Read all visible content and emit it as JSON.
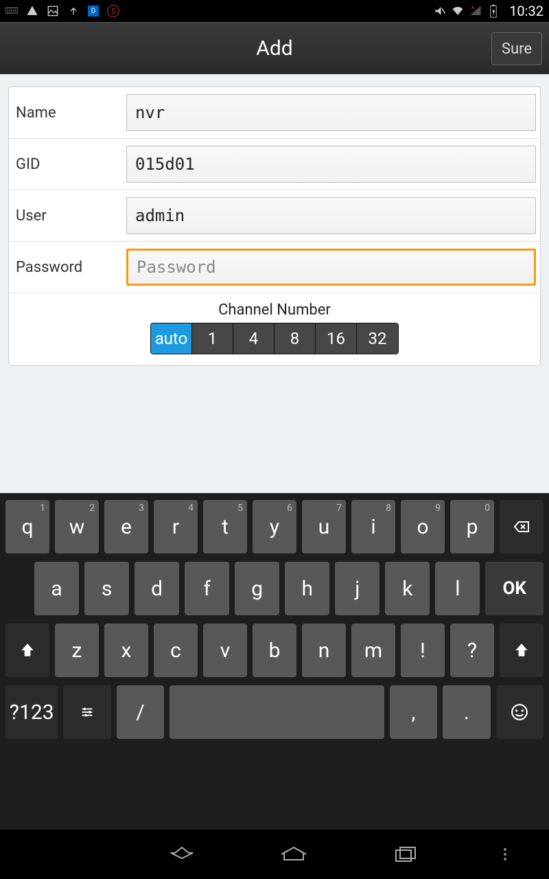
{
  "status": {
    "time": "10:32"
  },
  "header": {
    "title": "Add",
    "sure": "Sure"
  },
  "form": {
    "name": {
      "label": "Name",
      "value": "nvr"
    },
    "gid": {
      "label": "GID",
      "value": "015d01"
    },
    "user": {
      "label": "User",
      "value": "admin"
    },
    "password": {
      "label": "Password",
      "value": "",
      "placeholder": "Password"
    }
  },
  "channel": {
    "label": "Channel Number",
    "options": [
      "auto",
      "1",
      "4",
      "8",
      "16",
      "32"
    ],
    "selected": "auto"
  },
  "keyboard": {
    "row1": [
      {
        "k": "q",
        "n": "1"
      },
      {
        "k": "w",
        "n": "2"
      },
      {
        "k": "e",
        "n": "3"
      },
      {
        "k": "r",
        "n": "4"
      },
      {
        "k": "t",
        "n": "5"
      },
      {
        "k": "y",
        "n": "6"
      },
      {
        "k": "u",
        "n": "7"
      },
      {
        "k": "i",
        "n": "8"
      },
      {
        "k": "o",
        "n": "9"
      },
      {
        "k": "p",
        "n": "0"
      }
    ],
    "row2": [
      "a",
      "s",
      "d",
      "f",
      "g",
      "h",
      "j",
      "k",
      "l"
    ],
    "ok": "OK",
    "row3": [
      "z",
      "x",
      "c",
      "v",
      "b",
      "n",
      "m",
      "!",
      "?"
    ],
    "sym": "?123",
    "slash": "/",
    "comma": ",",
    "period": "."
  }
}
